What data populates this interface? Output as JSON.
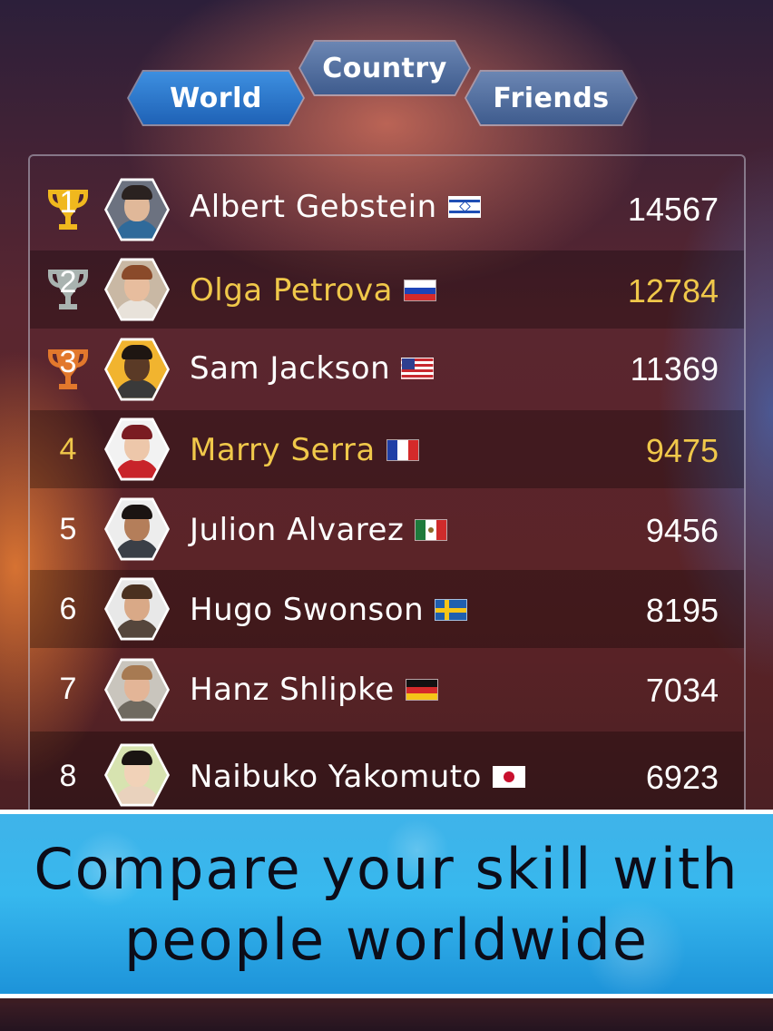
{
  "tabs": {
    "world": "World",
    "country": "Country",
    "friends": "Friends"
  },
  "leaderboard": [
    {
      "rank": "1",
      "name": "Albert Gebstein",
      "score": "14567",
      "flag": "israel-flag-icon",
      "highlight": false
    },
    {
      "rank": "2",
      "name": "Olga Petrova",
      "score": "12784",
      "flag": "russia-flag-icon",
      "highlight": true
    },
    {
      "rank": "3",
      "name": "Sam Jackson",
      "score": "11369",
      "flag": "usa-flag-icon",
      "highlight": false
    },
    {
      "rank": "4",
      "name": "Marry Serra",
      "score": "9475",
      "flag": "france-flag-icon",
      "highlight": true
    },
    {
      "rank": "5",
      "name": "Julion Alvarez",
      "score": "9456",
      "flag": "mexico-flag-icon",
      "highlight": false
    },
    {
      "rank": "6",
      "name": "Hugo Swonson",
      "score": "8195",
      "flag": "sweden-flag-icon",
      "highlight": false
    },
    {
      "rank": "7",
      "name": "Hanz Shlipke",
      "score": "7034",
      "flag": "germany-flag-icon",
      "highlight": false
    },
    {
      "rank": "8",
      "name": "Naibuko Yakomuto",
      "score": "6923",
      "flag": "japan-flag-icon",
      "highlight": false
    }
  ],
  "banner": {
    "line1": "Compare your skill with",
    "line2": "people worldwide"
  },
  "colors": {
    "gold": "#f0c84a",
    "silver": "#a9b3b0",
    "bronze": "#e2782c",
    "tab_active": "#2f7fd6",
    "tab_inactive": "#55709f",
    "banner": "#37b8ee"
  }
}
